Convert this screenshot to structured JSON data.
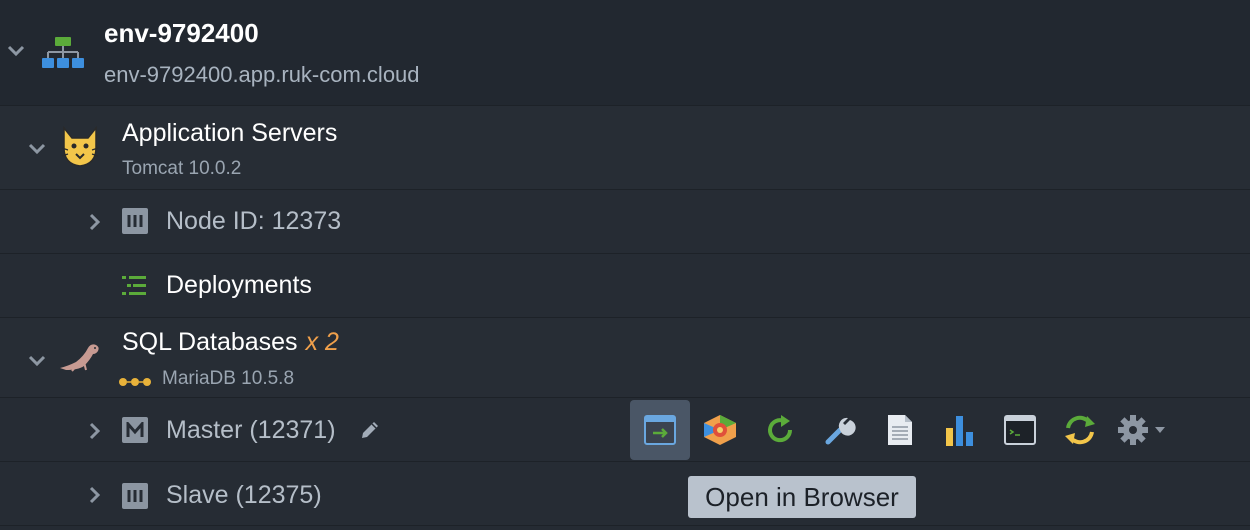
{
  "environment": {
    "name": "env-9792400",
    "domain": "env-9792400.app.ruk-com.cloud"
  },
  "app_servers": {
    "title": "Application Servers",
    "subtitle": "Tomcat 10.0.2",
    "node_label": "Node ID: 12373",
    "deployments_label": "Deployments"
  },
  "sql_databases": {
    "title": "SQL Databases",
    "multiplier": "x 2",
    "subtitle": "MariaDB 10.5.8",
    "master_label": "Master (12371)",
    "slave_label": "Slave (12375)"
  },
  "toolbar": {
    "tooltip": "Open in Browser",
    "buttons": [
      "open-in-browser-icon",
      "add-ons-icon",
      "restart-icon",
      "config-icon",
      "log-icon",
      "statistics-icon",
      "web-ssh-icon",
      "redeploy-icon",
      "settings-icon"
    ]
  },
  "colors": {
    "background": "#252b33",
    "accent_orange": "#f0a04b",
    "green": "#5bab3a",
    "blue": "#3d8fde"
  }
}
